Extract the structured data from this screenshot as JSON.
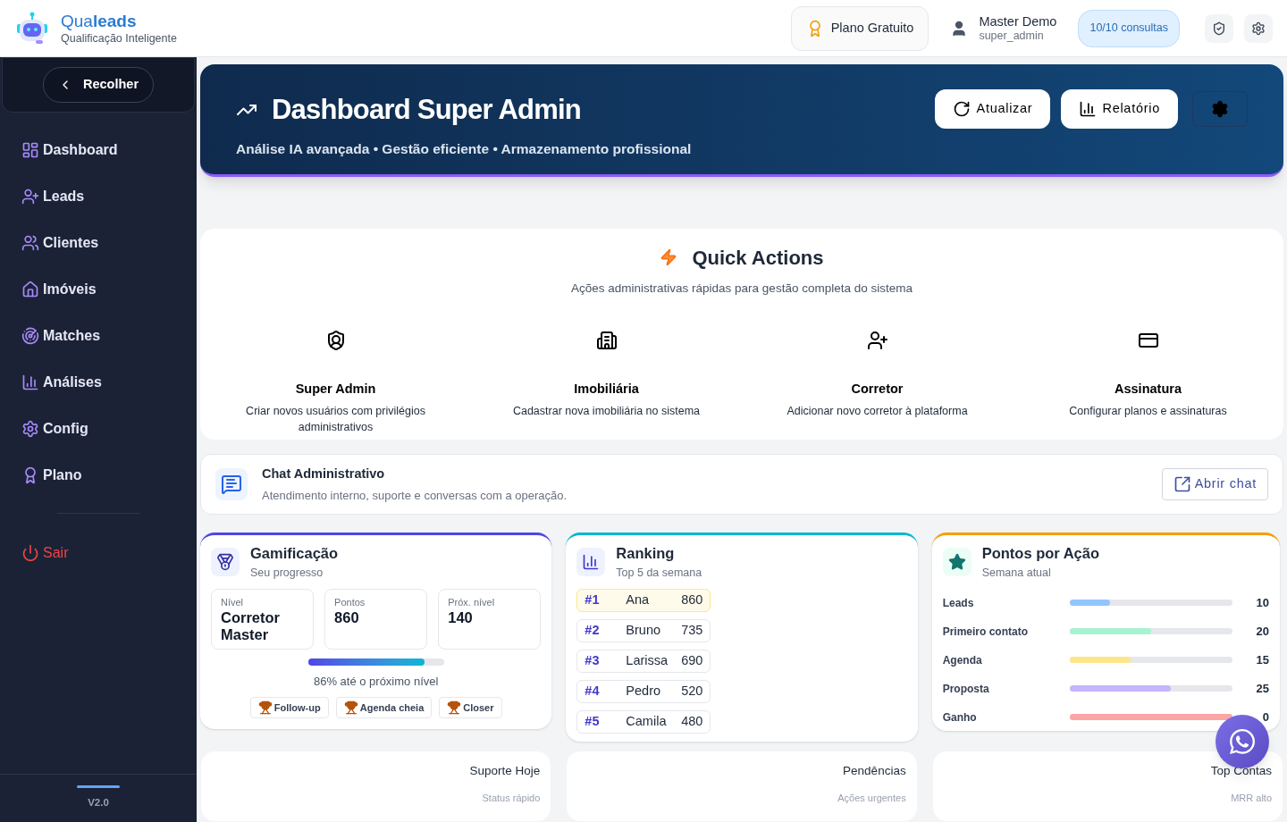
{
  "brand": {
    "name": "Qua**leads**",
    "tagline": "Qualificação Inteligente"
  },
  "header": {
    "plan": "Plano Gratuito",
    "user": {
      "name": "Master Demo",
      "role": "super_admin"
    },
    "quota": "10/10 consultas"
  },
  "sidebar": {
    "collapse": "Recolher",
    "items": [
      {
        "label": "Dashboard",
        "kind": "dashboard"
      },
      {
        "label": "Leads",
        "kind": "leads"
      },
      {
        "label": "Clientes",
        "kind": "clients"
      },
      {
        "label": "Imóveis",
        "kind": "properties"
      },
      {
        "label": "Matches",
        "kind": "matches"
      },
      {
        "label": "Análises",
        "kind": "analytics"
      },
      {
        "label": "Config",
        "kind": "config"
      },
      {
        "label": "Plano",
        "kind": "plan"
      }
    ],
    "logout": "Sair",
    "version": "V2.0"
  },
  "hero": {
    "title": "Dashboard Super Admin",
    "subtitle": "Análise IA avançada • Gestão eficiente • Armazenamento profissional",
    "buttons": [
      {
        "label": "Atualizar",
        "kind": "refresh"
      },
      {
        "label": "Relatório",
        "kind": "report"
      }
    ]
  },
  "quick_actions": {
    "title": "Quick Actions",
    "subtitle": "Ações administrativas rápidas para gestão completa do sistema",
    "items": [
      {
        "title": "Super Admin",
        "description": "Criar novos usuários com privilégios administrativos",
        "kind": "admin"
      },
      {
        "title": "Imobiliária",
        "description": "Cadastrar nova imobiliária no sistema",
        "kind": "agency"
      },
      {
        "title": "Corretor",
        "description": "Adicionar novo corretor à plataforma",
        "kind": "broker"
      },
      {
        "title": "Assinatura",
        "description": "Configurar planos e assinaturas",
        "kind": "subscription"
      }
    ]
  },
  "chat": {
    "title": "Chat Administrativo",
    "subtitle": "Atendimento interno, suporte e conversas com a operação.",
    "button": "Abrir chat"
  },
  "gamification": {
    "title": "Gamificação",
    "subtitle": "Seu progresso",
    "stats": [
      {
        "label": "Nível",
        "value": "Corretor Master"
      },
      {
        "label": "Pontos",
        "value": "860"
      },
      {
        "label": "Próx. nível",
        "value": "140"
      }
    ],
    "level": 0.86,
    "progress_text": "86% até o próximo nível",
    "badges": [
      "Follow-up",
      "Agenda cheia",
      "Closer"
    ]
  },
  "ranking": {
    "title": "Ranking",
    "subtitle": "Top 5 da semana",
    "rows": [
      {
        "rank": "#1",
        "name": "Ana",
        "points": "860",
        "selected": true
      },
      {
        "rank": "#2",
        "name": "Bruno",
        "points": "735",
        "selected": false
      },
      {
        "rank": "#3",
        "name": "Larissa",
        "points": "690",
        "selected": false
      },
      {
        "rank": "#4",
        "name": "Pedro",
        "points": "520",
        "selected": false
      },
      {
        "rank": "#5",
        "name": "Camila",
        "points": "480",
        "selected": false
      }
    ]
  },
  "points": {
    "title": "Pontos por Ação",
    "subtitle": "Semana atual",
    "rows": [
      {
        "label": "Leads",
        "level": 0.25,
        "value": "10",
        "color": "#93c5fd"
      },
      {
        "label": "Primeiro contato",
        "level": 0.5,
        "value": "20",
        "color": "#a7f3d0"
      },
      {
        "label": "Agenda",
        "level": 0.375,
        "value": "15",
        "color": "#fde68a"
      },
      {
        "label": "Proposta",
        "level": 0.625,
        "value": "25",
        "color": "#c4b5fd"
      },
      {
        "label": "Ganho",
        "level": 1,
        "value": "0",
        "color": "#fca5a5"
      }
    ]
  },
  "bottom_cards": [
    {
      "title": "Suporte Hoje",
      "subtitle": "Status rápido"
    },
    {
      "title": "Pendências",
      "subtitle": "Ações urgentes"
    },
    {
      "title": "Top Contas",
      "subtitle": "MRR alto"
    }
  ]
}
